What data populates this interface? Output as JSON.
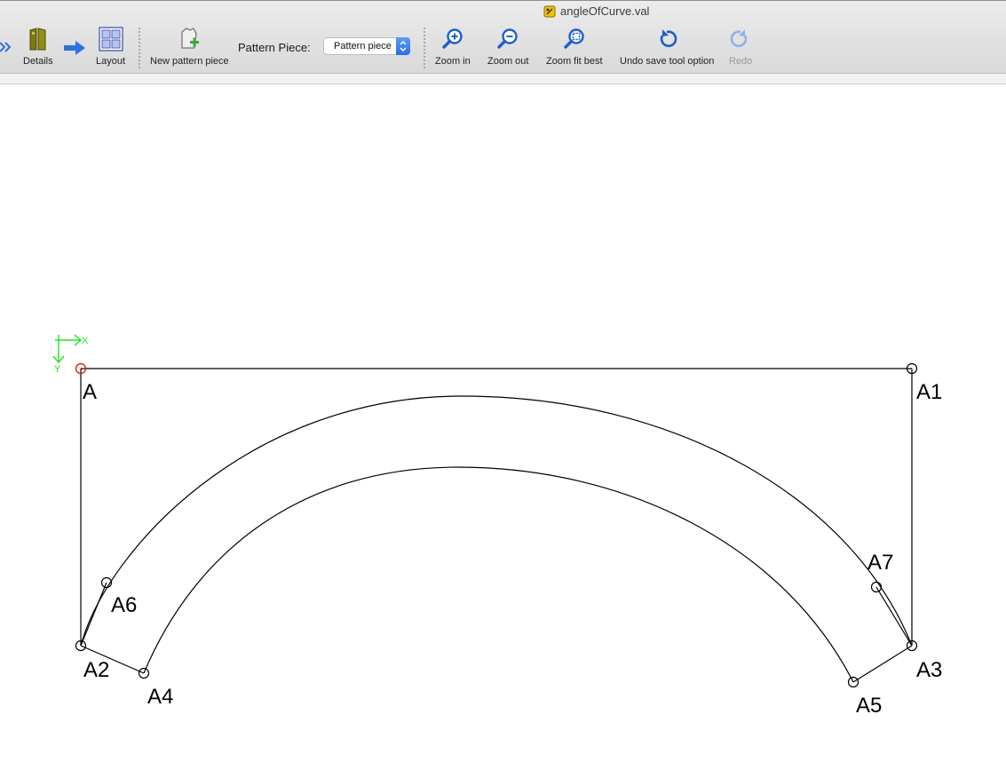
{
  "window": {
    "title": "angleOfCurve.val"
  },
  "toolbar": {
    "details_label": "Details",
    "layout_label": "Layout",
    "new_piece_label": "New pattern piece",
    "pattern_piece_label": "Pattern Piece:",
    "pattern_piece_value": "Pattern piece",
    "zoom_in_label": "Zoom in",
    "zoom_out_label": "Zoom out",
    "zoom_fit_label": "Zoom fit best",
    "undo_label": "Undo save tool option",
    "redo_label": "Redo"
  },
  "icons": {
    "details": "details-icon",
    "layout": "layout-icon",
    "new_piece": "new-pattern-piece-icon",
    "zoom_in": "zoom-in-icon",
    "zoom_out": "zoom-out-icon",
    "zoom_fit": "zoom-fit-icon",
    "undo": "undo-icon",
    "redo": "redo-icon"
  },
  "canvas": {
    "axis_x": "X",
    "axis_y": "Y",
    "points": {
      "A": "A",
      "A1": "A1",
      "A2": "A2",
      "A3": "A3",
      "A4": "A4",
      "A5": "A5",
      "A6": "A6",
      "A7": "A7"
    }
  },
  "colors": {
    "accent": "#2f6fe0",
    "origin_point": "#e02020",
    "axis": "#27e027",
    "olive_icon": "#7a7a10"
  }
}
